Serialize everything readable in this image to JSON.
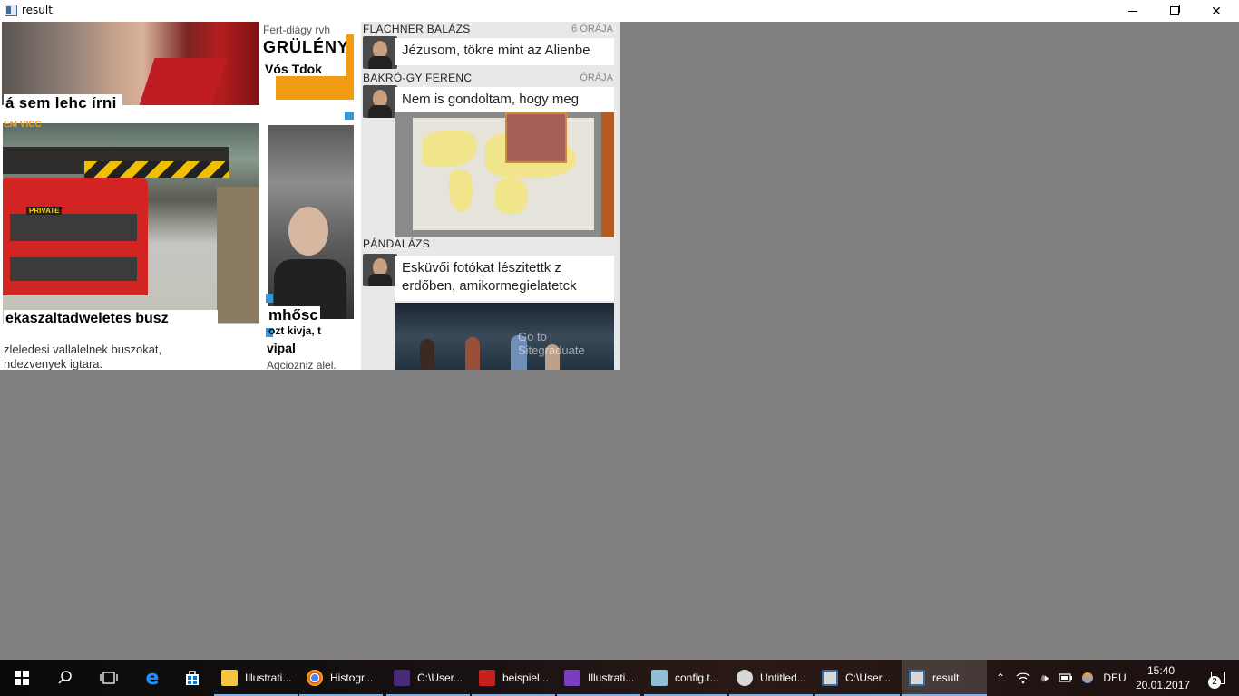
{
  "window": {
    "title": "result",
    "icon": "app-window-icon",
    "controls": {
      "minimize": "minimize-icon",
      "maximize": "restore-icon",
      "close": "close-icon"
    }
  },
  "content": {
    "left_column": {
      "headline_1": "á sem lehc írni",
      "tag": "EM VICC",
      "bus_sign": "PRIVATE",
      "headline_2": "ekaszaltadweletes busz",
      "sub_2_line1": "zleledesi vallalelnek buszokat,",
      "sub_2_line2": "ndezvenyek igtara."
    },
    "middle_column": {
      "top_small": "Fert-diágy rvh",
      "top_big": "GRÜLÉNY",
      "top_big2": "Vós Tdok",
      "headline": "mhősc",
      "sub1": "ozt kivja, t",
      "sub2": "vipal",
      "sub3": "Agciozniz alel."
    },
    "feed": {
      "posts": [
        {
          "author": "FLACHNER BALÁZS",
          "time": "6 ÓRÁJA",
          "text": "Jézusom, tökre mint az Alienbe"
        },
        {
          "author": "BAKRÓ-GY FERENC",
          "time": "ÓRÁJA",
          "text": "Nem is gondoltam, hogy meg"
        },
        {
          "author": "PÁNDALÁZS",
          "time": "",
          "text_line1": "Esküvői fotókat lészitettk z",
          "text_line2": "erdőben, amikormegielatetck",
          "link": "Go to Sitegraduate"
        }
      ]
    }
  },
  "taskbar": {
    "apps": [
      {
        "label": "Illustrati...",
        "icon": "folder-icon",
        "color": "#f5c542"
      },
      {
        "label": "Histogr...",
        "icon": "chrome-icon",
        "color": "#3c8d3c"
      },
      {
        "label": "C:\\User...",
        "icon": "latex-icon",
        "color": "#4a2a7a"
      },
      {
        "label": "beispiel...",
        "icon": "pdf-icon",
        "color": "#c8201e"
      },
      {
        "label": "Illustrati...",
        "icon": "visual-studio-icon",
        "color": "#7a3ec0"
      },
      {
        "label": "config.t...",
        "icon": "notepad-icon",
        "color": "#8fc0d8"
      },
      {
        "label": "Untitled...",
        "icon": "paint-icon",
        "color": "#d8d8d8"
      },
      {
        "label": "C:\\User...",
        "icon": "console-icon",
        "color": "#d8d8d8"
      },
      {
        "label": "result",
        "icon": "app-window-icon",
        "color": "#d8d8d8"
      }
    ],
    "language": "DEU",
    "time": "15:40",
    "date": "20.01.2017",
    "notification_count": "2"
  }
}
